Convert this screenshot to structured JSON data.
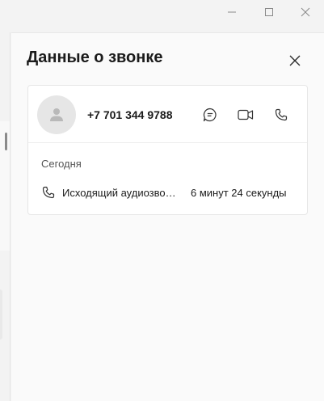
{
  "window": {
    "minimize_icon": "minimize-icon",
    "maximize_icon": "maximize-icon",
    "close_icon": "close-icon"
  },
  "panel": {
    "title": "Данные о звонке",
    "close_icon": "close-icon"
  },
  "contact": {
    "avatar_icon": "person-icon",
    "phone": "+7 701 344 9788",
    "actions": [
      {
        "name": "chat",
        "icon": "chat-icon"
      },
      {
        "name": "video",
        "icon": "video-camera-icon"
      },
      {
        "name": "call",
        "icon": "phone-icon"
      }
    ]
  },
  "history": {
    "date_label": "Сегодня",
    "entries": [
      {
        "icon": "phone-icon",
        "description": "Исходящий аудиозвонок",
        "duration": "6 минут 24 секунды"
      }
    ]
  },
  "colors": {
    "background": "#f3f3f3",
    "panel": "#fafafa",
    "card": "#ffffff",
    "avatar": "#e6e6e6"
  }
}
